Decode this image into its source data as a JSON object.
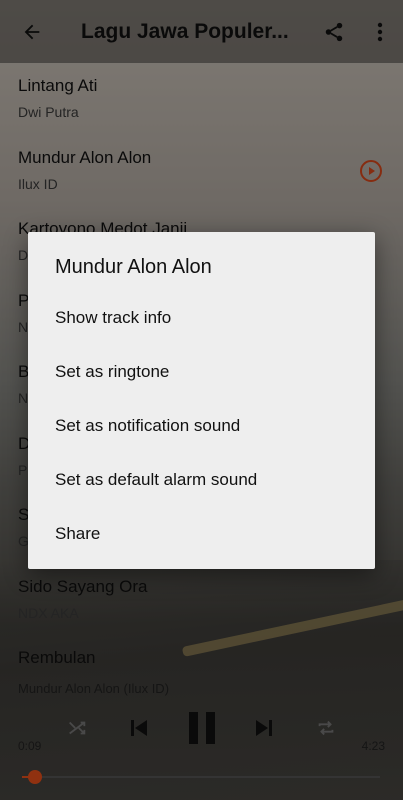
{
  "app_bar": {
    "title": "Lagu Jawa Populer...",
    "back_icon": "arrow-left-icon",
    "share_icon": "share-icon",
    "more_icon": "more-vert-icon"
  },
  "tracks": [
    {
      "name": "Lintang Ati",
      "artist": "Dwi Putra"
    },
    {
      "name": "Mundur Alon Alon",
      "artist": "Ilux ID"
    },
    {
      "name": "Kartoyono Medot Janji",
      "artist": "D"
    },
    {
      "name": "P",
      "artist": "N"
    },
    {
      "name": "B",
      "artist": "N"
    },
    {
      "name": "D",
      "artist": "P"
    },
    {
      "name": "S",
      "artist": "G"
    },
    {
      "name": "Sido Sayang Ora",
      "artist": "NDX AKA"
    },
    {
      "name": "Rembulan",
      "artist": ""
    }
  ],
  "playing_index_icon": "play-circle-icon",
  "player": {
    "now_playing": "Mundur Alon Alon (Ilux ID)",
    "elapsed": "0:09",
    "duration": "4:23",
    "progress": 0.035,
    "accent": "#e8501b"
  },
  "dialog": {
    "title": "Mundur Alon Alon",
    "options": [
      "Show track info",
      "Set as ringtone",
      "Set as notification sound",
      "Set as default alarm sound",
      "Share"
    ]
  }
}
